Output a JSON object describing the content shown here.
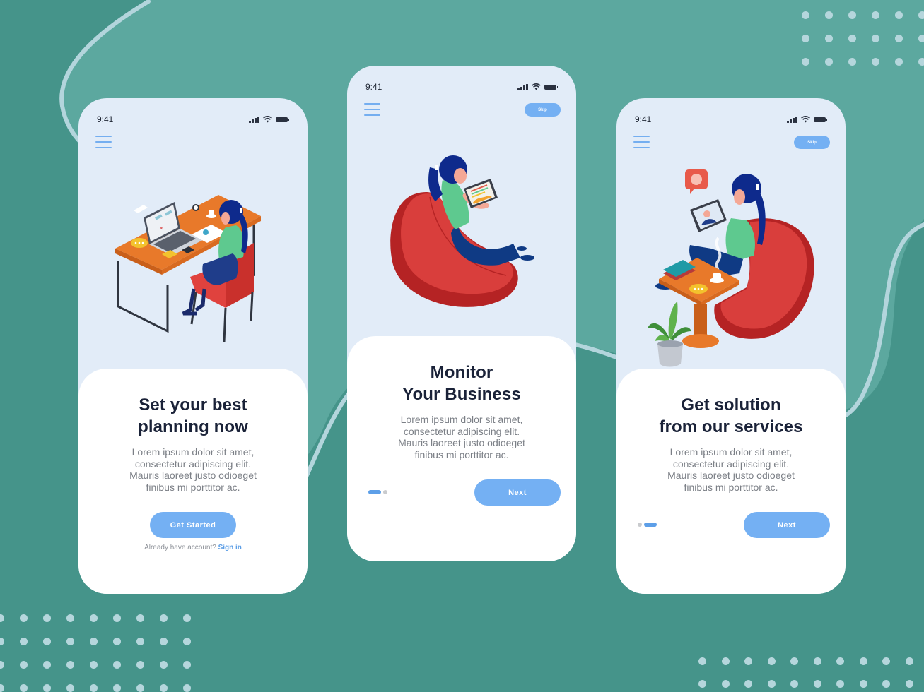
{
  "theme": {
    "background": "#45948a",
    "background_light": "#5ca89f",
    "curve_stroke": "#b3d5dc",
    "dot_color": "#b5d6dc",
    "phone_bg": "#e2ecf8",
    "card_bg": "#ffffff",
    "accent": "#74b0f3",
    "title_color": "#1a2238",
    "body_color": "#7b7f86"
  },
  "screens": [
    {
      "status": {
        "time": "9:41"
      },
      "illustration": "woman-working-at-desk-with-laptop",
      "title_line1": "Set your best",
      "title_line2": "planning now",
      "body": [
        "Lorem ipsum dolor sit amet,",
        "consectetur adipiscing elit.",
        "Mauris laoreet justo odioeget",
        "finibus mi porttitor ac."
      ],
      "primary_button": "Get Started",
      "signin_prompt": "Already have account?",
      "signin_link": "Sign in"
    },
    {
      "status": {
        "time": "9:41"
      },
      "skip_label": "Skip",
      "illustration": "woman-in-bean-bag-with-tablet-chart",
      "title_line1": "Monitor",
      "title_line2": "Your Business",
      "body": [
        "Lorem ipsum dolor sit amet,",
        "consectetur adipiscing elit.",
        "Mauris laoreet justo odioeget",
        "finibus mi porttitor ac."
      ],
      "primary_button": "Next",
      "pager": {
        "total": 2,
        "active_index": 0
      }
    },
    {
      "status": {
        "time": "9:41"
      },
      "skip_label": "Skip",
      "illustration": "woman-video-call-with-coffee-table-and-plant",
      "title_line1": "Get solution",
      "title_line2": "from our services",
      "body": [
        "Lorem ipsum dolor sit amet,",
        "consectetur adipiscing elit.",
        "Mauris laoreet justo odioeget",
        "finibus mi porttitor ac."
      ],
      "primary_button": "Next",
      "pager": {
        "total": 2,
        "active_index": 1
      }
    }
  ]
}
